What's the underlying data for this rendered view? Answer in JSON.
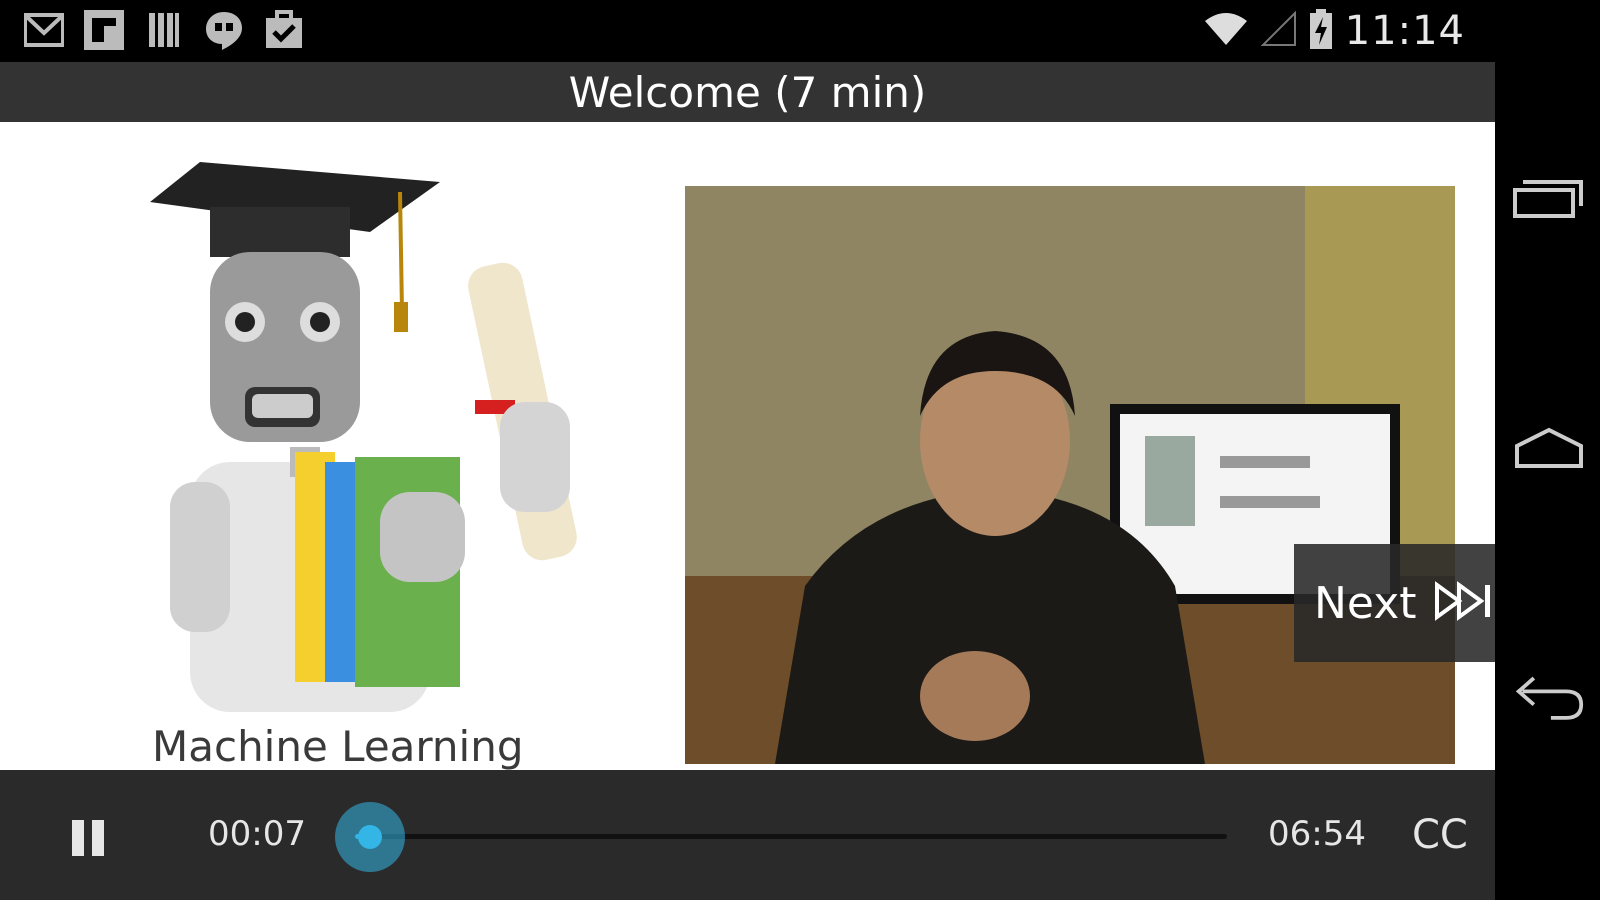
{
  "status_bar": {
    "notification_icons": [
      "gmail-icon",
      "flipboard-icon",
      "library-icon",
      "hangouts-icon",
      "task-icon"
    ],
    "status_icons": [
      "wifi-icon",
      "signal-icon",
      "battery-charging-icon"
    ],
    "time": "11:14"
  },
  "title_bar": {
    "title": "Welcome (7 min)"
  },
  "video": {
    "slide_caption": "Machine Learning",
    "next_label": "Next",
    "next_icon": "skip-next-icon"
  },
  "controls": {
    "pause_icon": "pause-icon",
    "current_time": "00:07",
    "total_time": "06:54",
    "progress_fraction": 0.017,
    "captions_label": "CC",
    "accent_color": "#33b5e5"
  },
  "nav_bar": {
    "icons": [
      "recent-apps-icon",
      "home-icon",
      "back-icon"
    ]
  }
}
